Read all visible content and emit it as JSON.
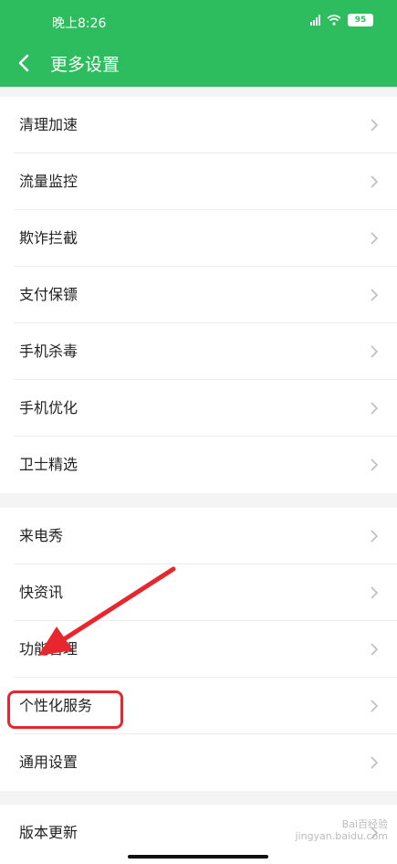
{
  "status": {
    "time": "晚上8:26",
    "battery": "95"
  },
  "header": {
    "title": "更多设置"
  },
  "groups": [
    {
      "items": [
        "清理加速",
        "流量监控",
        "欺诈拦截",
        "支付保镖",
        "手机杀毒",
        "手机优化",
        "卫士精选"
      ]
    },
    {
      "items": [
        "来电秀",
        "快资讯",
        "功能管理",
        "个性化服务",
        "通用设置"
      ]
    },
    {
      "items": [
        "版本更新"
      ]
    }
  ],
  "colors": {
    "accent": "#2dbd5e",
    "annotation": "#e8262d"
  },
  "icons": {
    "back": "chevron-left-icon",
    "item": "chevron-right-icon"
  },
  "watermark": {
    "line1": "Bai百经验",
    "line2": "jingyan.baidu.com"
  }
}
